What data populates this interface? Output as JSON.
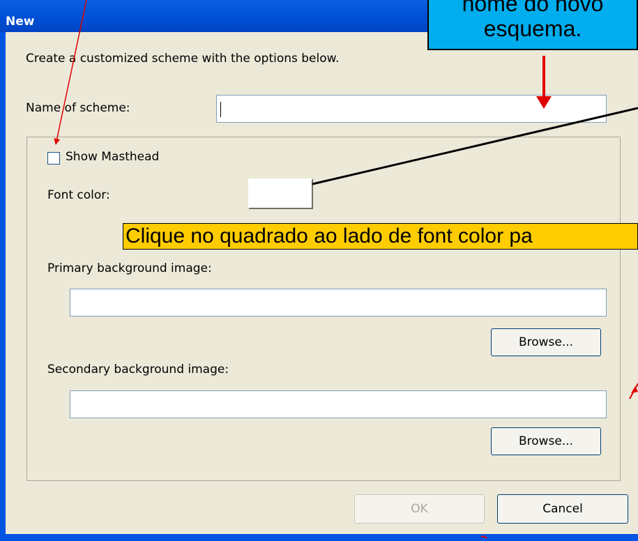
{
  "window": {
    "title": "New"
  },
  "dialog": {
    "instruction": "Create a customized scheme with the options below.",
    "name_label": "Name of scheme:",
    "name_value": "",
    "show_masthead_label": "Show Masthead",
    "show_masthead_checked": false,
    "font_color_label": "Font color:",
    "primary_bg_label": "Primary background image:",
    "primary_bg_value": "",
    "secondary_bg_label": "Secondary background image:",
    "secondary_bg_value": "",
    "browse_label": "Browse...",
    "ok_label": "OK",
    "cancel_label": "Cancel"
  },
  "annotations": {
    "top_callout_line1": "nome do novo",
    "top_callout_line2": "esquema.",
    "yellow_callout": "Clique no quadrado ao lado de font color pa"
  },
  "colors": {
    "titlebar": "#0054E3",
    "dialog_bg": "#ECE9D8",
    "callout_blue": "#00AEEF",
    "callout_yellow": "#FFCC00",
    "arrow_red": "#E00000"
  }
}
